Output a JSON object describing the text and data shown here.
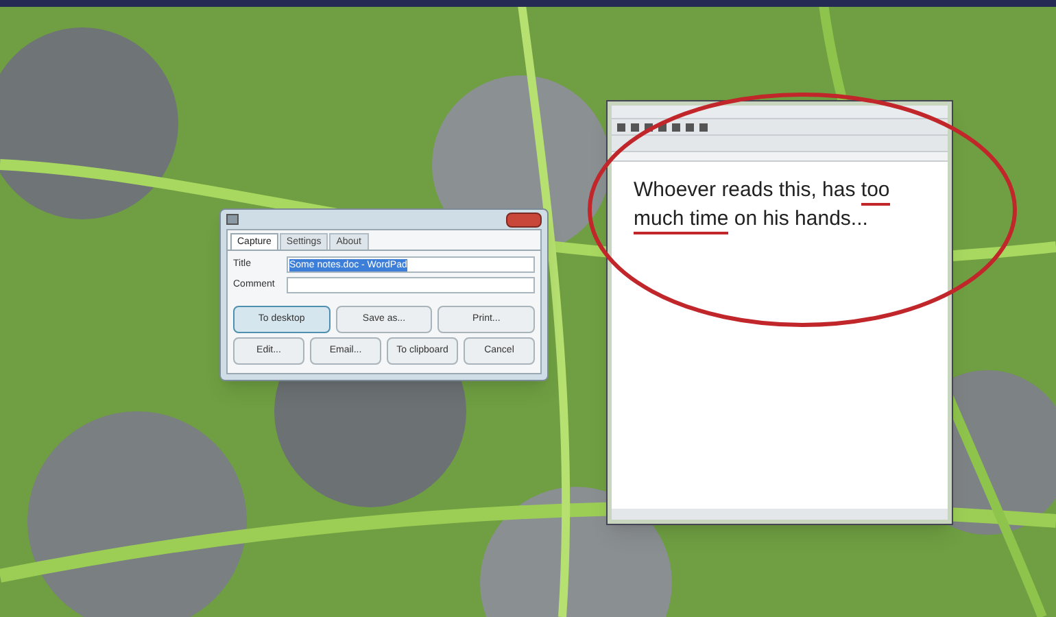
{
  "dialog": {
    "tabs": [
      {
        "label": "Capture",
        "selected": true
      },
      {
        "label": "Settings",
        "selected": false
      },
      {
        "label": "About",
        "selected": false
      }
    ],
    "fields": [
      {
        "label": "Title",
        "value": "Some notes.doc - WordPad",
        "text_selected": true
      },
      {
        "label": "Comment"
      }
    ],
    "buttons": [
      {
        "label": "To desktop",
        "default": true
      },
      {
        "label": "Save as...",
        "default": false
      },
      {
        "label": "Print...",
        "default": false
      },
      {
        "label": "Edit...",
        "default": false
      },
      {
        "label": "Email...",
        "default": false
      },
      {
        "label": "To clipboard",
        "default": false
      },
      {
        "label": "Cancel",
        "default": false
      }
    ]
  },
  "document": {
    "lines": [
      [
        {
          "text": "Whoever reads this, has ",
          "underlined": false
        },
        {
          "text": "too",
          "underlined": true
        }
      ],
      [
        {
          "text": "much time",
          "underlined": true
        },
        {
          "text": " on his hands...",
          "underlined": false
        }
      ]
    ]
  }
}
